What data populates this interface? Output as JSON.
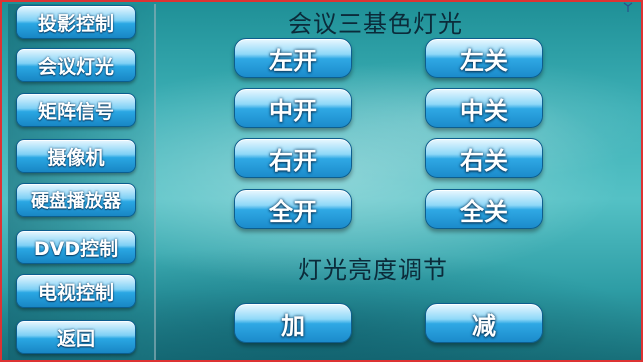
{
  "sidebar": {
    "items": [
      {
        "label": "投影控制"
      },
      {
        "label": "会议灯光"
      },
      {
        "label": "矩阵信号"
      },
      {
        "label": "摄像机"
      },
      {
        "label": "硬盘播放器"
      },
      {
        "label": "DVD控制"
      },
      {
        "label": "电视控制"
      },
      {
        "label": "返回"
      }
    ]
  },
  "main": {
    "section_title": "会议三基色灯光",
    "buttons": {
      "left_on": "左开",
      "left_off": "左关",
      "mid_on": "中开",
      "mid_off": "中关",
      "right_on": "右开",
      "right_off": "右关",
      "all_on": "全开",
      "all_off": "全关"
    },
    "brightness_title": "灯光亮度调节",
    "brightness": {
      "up": "加",
      "down": "减"
    }
  },
  "corner_icon": "antenna-icon",
  "colors": {
    "accent_blue": "#2aa7e3",
    "title_text": "#0b2b3a",
    "border_red": "#d33"
  }
}
